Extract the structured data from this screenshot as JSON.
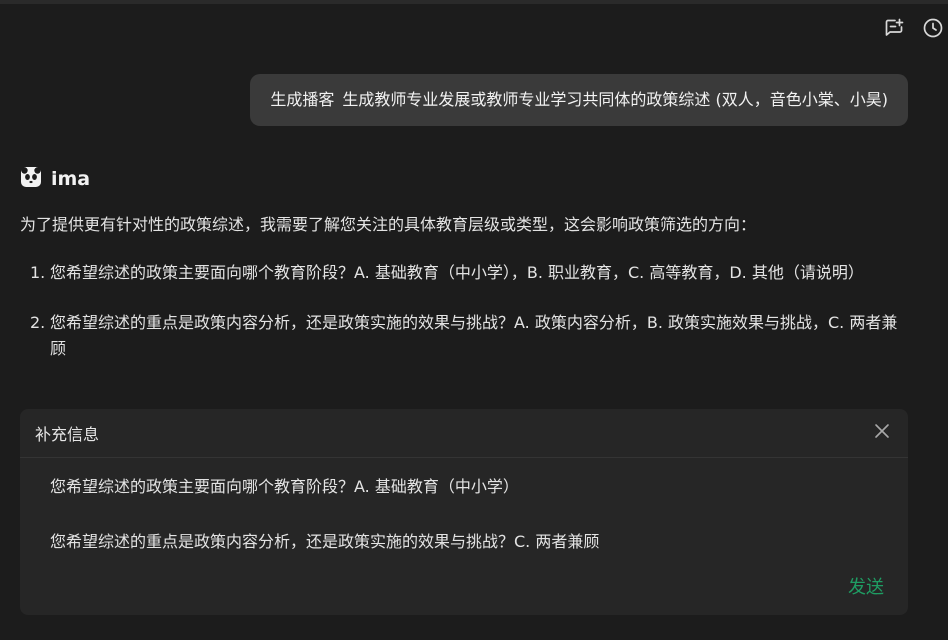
{
  "toolbar": {
    "icons": [
      "note-add-icon",
      "clock-icon"
    ]
  },
  "user_message": {
    "part1": "生成播客",
    "part2": "生成教师专业发展或教师专业学习共同体的政策综述 (双人，音色小棠、小昊)"
  },
  "assistant": {
    "name": "ima",
    "avatar_icon": "panda-icon",
    "intro": "为了提供更有针对性的政策综述，我需要了解您关注的具体教育层级或类型，这会影响政策筛选的方向：",
    "questions": [
      {
        "num": "1.",
        "text": "您希望综述的政策主要面向哪个教育阶段？A. 基础教育（中小学），B. 职业教育，C. 高等教育，D. 其他（请说明）"
      },
      {
        "num": "2.",
        "text": "您希望综述的重点是政策内容分析，还是政策实施的效果与挑战？A. 政策内容分析，B. 政策实施效果与挑战，C. 两者兼顾"
      }
    ]
  },
  "supplement": {
    "title": "补充信息",
    "answer1": "您希望综述的政策主要面向哪个教育阶段？A. 基础教育（中小学）",
    "answer2": "您希望综述的重点是政策内容分析，还是政策实施的效果与挑战？C. 两者兼顾",
    "send_label": "发送",
    "send_color": "#1f9d63"
  }
}
